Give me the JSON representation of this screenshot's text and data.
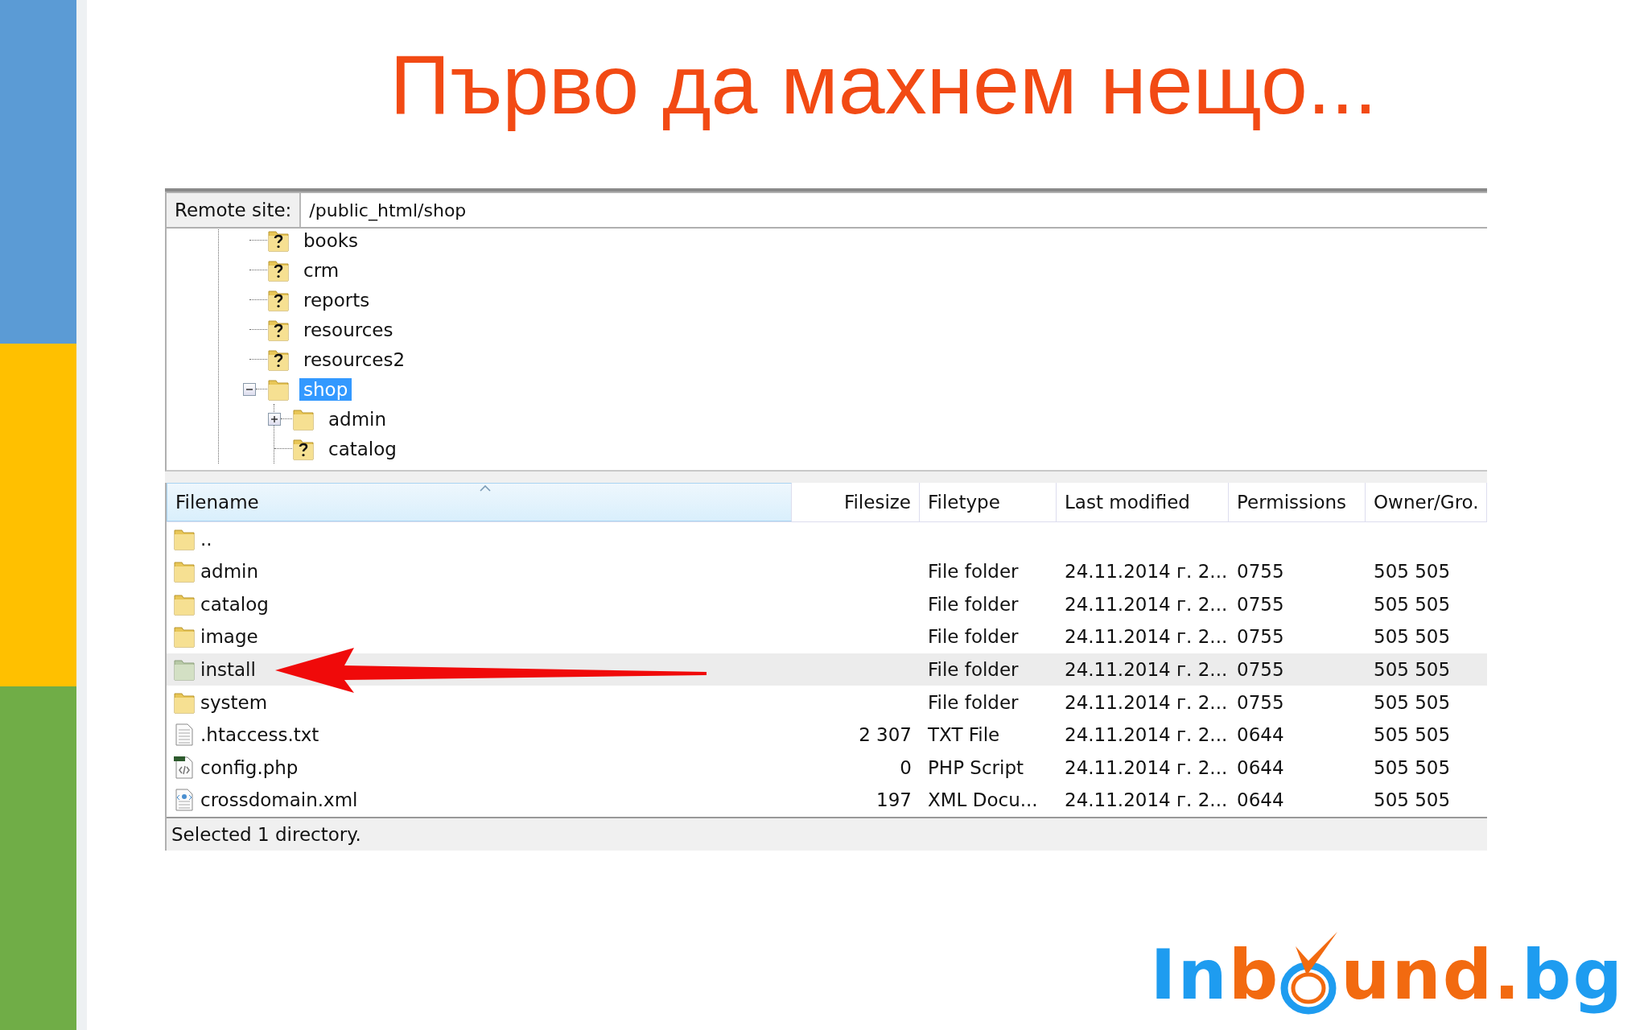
{
  "title": "Първо да махнем нещо...",
  "remote_site": {
    "label": "Remote site:",
    "value": "/public_html/shop"
  },
  "tree": [
    {
      "label": "books",
      "kind": "unknown",
      "selected": false
    },
    {
      "label": "crm",
      "kind": "unknown",
      "selected": false
    },
    {
      "label": "reports",
      "kind": "unknown",
      "selected": false
    },
    {
      "label": "resources",
      "kind": "unknown",
      "selected": false
    },
    {
      "label": "resources2",
      "kind": "unknown",
      "selected": false
    },
    {
      "label": "shop",
      "kind": "folder",
      "selected": true,
      "expanded": true,
      "children": [
        {
          "label": "admin",
          "kind": "folder",
          "selected": false,
          "expanded": false
        },
        {
          "label": "catalog",
          "kind": "unknown",
          "selected": false
        }
      ]
    }
  ],
  "table": {
    "columns": [
      {
        "label": "Filename",
        "sorted": true
      },
      {
        "label": "Filesize",
        "sorted": false
      },
      {
        "label": "Filetype",
        "sorted": false
      },
      {
        "label": "Last modified",
        "sorted": false
      },
      {
        "label": "Permissions",
        "sorted": false
      },
      {
        "label": "Owner/Gro.",
        "sorted": false
      }
    ],
    "rows": [
      {
        "kind": "folder",
        "selected": false,
        "cells": [
          "..",
          "",
          "",
          "",
          "",
          ""
        ]
      },
      {
        "kind": "folder",
        "selected": false,
        "cells": [
          "admin",
          "",
          "File folder",
          "24.11.2014 г. 2...",
          "0755",
          "505 505"
        ]
      },
      {
        "kind": "folder",
        "selected": false,
        "cells": [
          "catalog",
          "",
          "File folder",
          "24.11.2014 г. 2...",
          "0755",
          "505 505"
        ]
      },
      {
        "kind": "folder",
        "selected": false,
        "cells": [
          "image",
          "",
          "File folder",
          "24.11.2014 г. 2...",
          "0755",
          "505 505"
        ]
      },
      {
        "kind": "folder",
        "selected": true,
        "cells": [
          "install",
          "",
          "File folder",
          "24.11.2014 г. 2...",
          "0755",
          "505 505"
        ]
      },
      {
        "kind": "folder",
        "selected": false,
        "cells": [
          "system",
          "",
          "File folder",
          "24.11.2014 г. 2...",
          "0755",
          "505 505"
        ]
      },
      {
        "kind": "text",
        "selected": false,
        "cells": [
          ".htaccess.txt",
          "2 307",
          "TXT File",
          "24.11.2014 г. 2...",
          "0644",
          "505 505"
        ]
      },
      {
        "kind": "script",
        "selected": false,
        "cells": [
          "config.php",
          "0",
          "PHP Script",
          "24.11.2014 г. 2...",
          "0644",
          "505 505"
        ]
      },
      {
        "kind": "xml",
        "selected": false,
        "cells": [
          "crossdomain.xml",
          "197",
          "XML Docu...",
          "24.11.2014 г. 2...",
          "0644",
          "505 505"
        ]
      }
    ]
  },
  "status_bar": "Selected 1 directory.",
  "logo": [
    {
      "kind": "text",
      "text": "In",
      "color": "#1e9cf0"
    },
    {
      "kind": "text",
      "text": "b",
      "color": "#f26a10"
    },
    {
      "kind": "target"
    },
    {
      "kind": "text",
      "text": "und.",
      "color": "#f26a10"
    },
    {
      "kind": "text",
      "text": "bg",
      "color": "#1e9cf0"
    }
  ]
}
